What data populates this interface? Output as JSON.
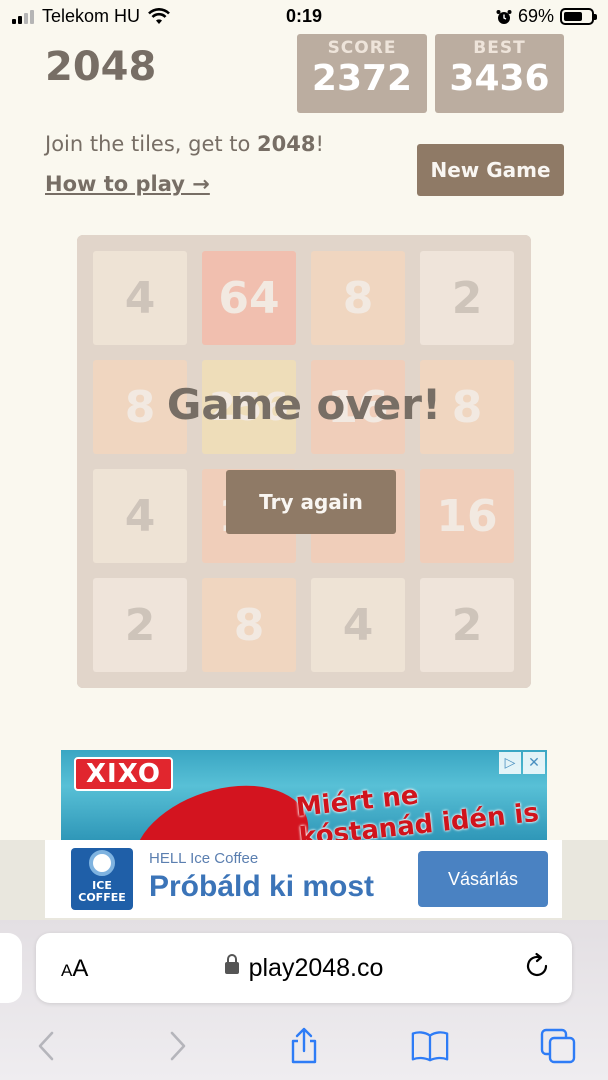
{
  "status": {
    "carrier": "Telekom HU",
    "time": "0:19",
    "battery": "69%",
    "battery_level": 0.69
  },
  "header": {
    "title": "2048",
    "score_label": "SCORE",
    "score": "2372",
    "best_label": "BEST",
    "best": "3436"
  },
  "intro": {
    "text_before": "Join the tiles, get to ",
    "text_bold": "2048",
    "text_after": "!",
    "howto": "How to play →",
    "new_game": "New Game"
  },
  "board": {
    "tiles": [
      [
        "4",
        "64",
        "8",
        "2"
      ],
      [
        "8",
        "256",
        "16",
        "8"
      ],
      [
        "4",
        "16",
        "16",
        "16"
      ],
      [
        "2",
        "8",
        "4",
        "2"
      ]
    ],
    "overlay_message": "Game over!",
    "try_again": "Try again"
  },
  "ad_top": {
    "brand": "XIXO",
    "headline": "Miért ne kóstanád idén is"
  },
  "ad_banner": {
    "sponsor": "HELL Ice Coffee",
    "headline": "Próbáld ki most",
    "cta": "Vásárlás",
    "logo_line1": "ICE",
    "logo_line2": "COFFEE"
  },
  "browser": {
    "aa": "AA",
    "url": "play2048.co"
  }
}
